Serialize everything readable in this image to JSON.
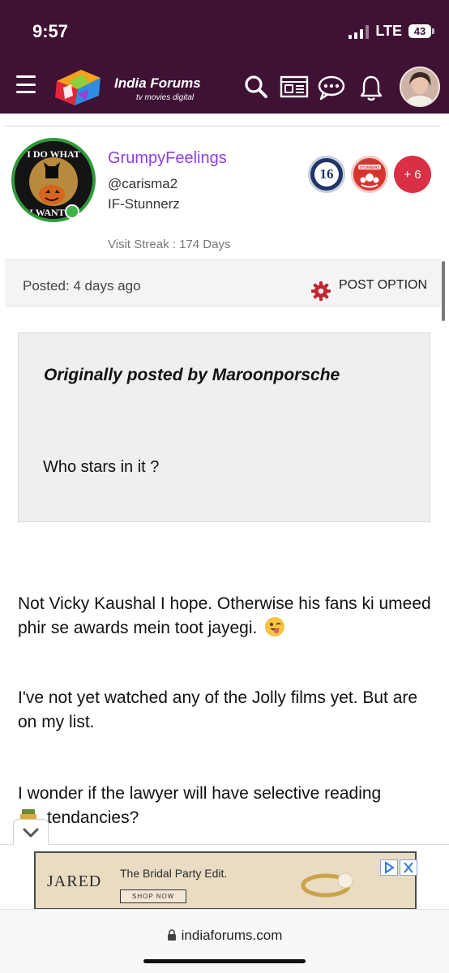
{
  "status_bar": {
    "time": "9:57",
    "network": "LTE",
    "battery": "43"
  },
  "header": {
    "title": "India Forums",
    "subtitle": "tv  movies  digital",
    "icons": [
      "menu-icon",
      "search-icon",
      "news-icon",
      "chat-icon",
      "bell-icon"
    ],
    "colors": {
      "background": "#3e1135"
    }
  },
  "profile": {
    "avatar_text_top": "I DO WHAT",
    "avatar_text_bottom": "I WANT",
    "username": "GrumpyFeelings",
    "handle": "@carisma2",
    "group": "IF-Stunnerz",
    "visit_streak": "Visit Streak : 174 Days",
    "badges": {
      "years": "16",
      "stunnerz": "STUNNERZ",
      "more": "+ 6"
    },
    "colors": {
      "username": "#8b3fe0",
      "online": "#3fb24a"
    }
  },
  "post": {
    "posted": "Posted: 4 days ago",
    "option_label": "POST OPTION"
  },
  "quote": {
    "by": "Originally posted by Maroonporsche",
    "text": "Who stars in it ?"
  },
  "body": {
    "p1": "Not Vicky Kaushal I hope. Otherwise his fans ki umeed phir se awards mein toot jayegi.",
    "p2": "I've not yet watched any of the Jolly films yet. But are on my list.",
    "p3_line1": "I wonder if the lawyer will have selective reading",
    "p3_line2": "tendancies?"
  },
  "ad": {
    "brand": "JARED",
    "title": "The Bridal Party Edit.",
    "cta": "SHOP NOW"
  },
  "browser": {
    "url": "indiaforums.com"
  }
}
